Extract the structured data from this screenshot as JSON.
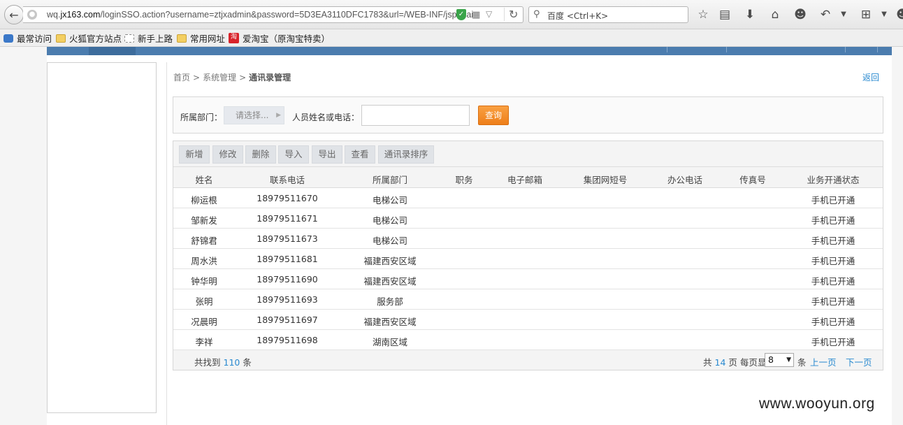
{
  "browser": {
    "url_prefix": "wq.",
    "url_domain": "jx163.com",
    "url_path": "/loginSSO.action?username=ztjxadmin&password=5D3EA3110DFC1783&url=/WEB-INF/jsp/mai",
    "search_placeholder": "百度 <Ctrl+K>",
    "toolbar_icons": [
      "star-icon",
      "reading-list-icon",
      "download-icon",
      "home-icon",
      "chat-icon",
      "undo-icon",
      "dropdown-icon",
      "crop-icon",
      "dropdown-icon",
      "chat-icon"
    ]
  },
  "bookmarks": [
    {
      "label": "最常访问",
      "icon": "blue-bookmark-icon"
    },
    {
      "label": "火狐官方站点",
      "icon": "folder-icon"
    },
    {
      "label": "新手上路",
      "icon": "page-icon"
    },
    {
      "label": "常用网址",
      "icon": "folder-icon"
    },
    {
      "label": "爱淘宝（原淘宝特卖）",
      "icon": "taobao-icon",
      "icon_text": "淘"
    }
  ],
  "breadcrumb": {
    "home": "首页",
    "sep": ">",
    "level1": "系统管理",
    "current": "通讯录管理"
  },
  "back_label": "返回",
  "search": {
    "dept_label": "所属部门：",
    "dept_placeholder": "请选择...",
    "name_label": "人员姓名或电话：",
    "name_value": "",
    "query_label": "查询"
  },
  "toolbar": {
    "add": "新增",
    "edit": "修改",
    "delete": "删除",
    "import": "导入",
    "export": "导出",
    "view": "查看",
    "sort": "通讯录排序"
  },
  "table": {
    "headers": [
      "姓名",
      "联系电话",
      "所属部门",
      "职务",
      "电子邮箱",
      "集团网短号",
      "办公电话",
      "传真号",
      "业务开通状态"
    ],
    "rows": [
      [
        "柳运根",
        "18979511670",
        "电梯公司",
        "",
        "",
        "",
        "",
        "",
        "手机已开通"
      ],
      [
        "邹新发",
        "18979511671",
        "电梯公司",
        "",
        "",
        "",
        "",
        "",
        "手机已开通"
      ],
      [
        "舒锦君",
        "18979511673",
        "电梯公司",
        "",
        "",
        "",
        "",
        "",
        "手机已开通"
      ],
      [
        "周水洪",
        "18979511681",
        "福建西安区域",
        "",
        "",
        "",
        "",
        "",
        "手机已开通"
      ],
      [
        "钟华明",
        "18979511690",
        "福建西安区域",
        "",
        "",
        "",
        "",
        "",
        "手机已开通"
      ],
      [
        "张明",
        "18979511693",
        "服务部",
        "",
        "",
        "",
        "",
        "",
        "手机已开通"
      ],
      [
        "况晨明",
        "18979511697",
        "福建西安区域",
        "",
        "",
        "",
        "",
        "",
        "手机已开通"
      ],
      [
        "李祥",
        "18979511698",
        "湖南区域",
        "",
        "",
        "",
        "",
        "",
        "手机已开通"
      ]
    ]
  },
  "footer": {
    "found_prefix": "共找到",
    "found_count": "110",
    "found_suffix": "条",
    "pages_prefix": "共",
    "pages_count": "14",
    "pages_suffix": "页 每页显",
    "page_size": "8",
    "per_unit": "条",
    "prev": "上一页",
    "next": "下一页"
  },
  "watermark": "www.wooyun.org"
}
